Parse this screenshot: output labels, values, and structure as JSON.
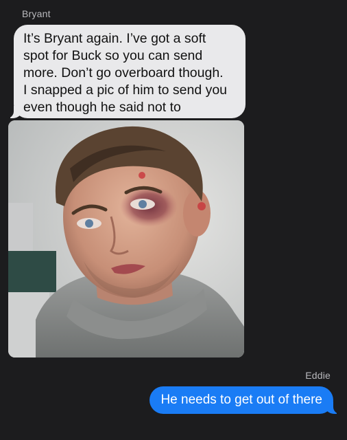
{
  "thread": {
    "incoming": {
      "sender": "Bryant",
      "message_lines": [
        "It’s Bryant again. I’ve got a soft",
        "spot for Buck so you can send",
        "more. Don’t go overboard though.",
        "I snapped a pic of him to send you",
        "even though he said not to"
      ],
      "attachment": {
        "type": "photo",
        "alt": "Photo of man with bruised eye"
      }
    },
    "outgoing": {
      "sender": "Eddie",
      "message": "He needs to get out of there"
    }
  },
  "colors": {
    "background": "#1c1c1e",
    "incoming_bubble": "#e9e9eb",
    "outgoing_bubble": "#1a7cf5",
    "sender_label": "#b9b9bd"
  }
}
